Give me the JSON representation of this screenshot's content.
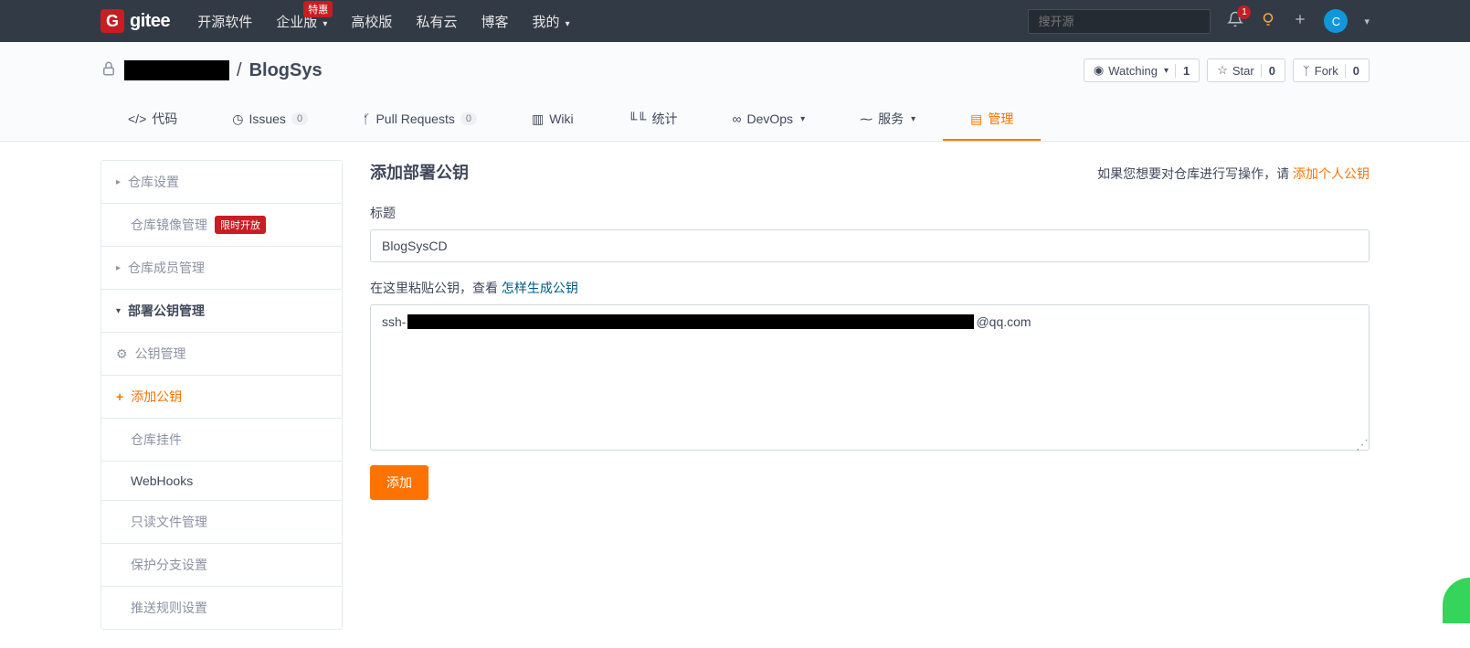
{
  "top": {
    "brand": "gitee",
    "nav": [
      "开源软件",
      "企业版",
      "高校版",
      "私有云",
      "博客",
      "我的"
    ],
    "promo_badge": "特惠",
    "search_placeholder": "搜开源",
    "notif_count": "1",
    "avatar_letter": "C"
  },
  "repo": {
    "separator": "/",
    "name": "BlogSys",
    "actions": {
      "watch": "Watching",
      "watch_count": "1",
      "star": "Star",
      "star_count": "0",
      "fork": "Fork",
      "fork_count": "0"
    },
    "tabs": {
      "code": "代码",
      "issues": "Issues",
      "issues_count": "0",
      "pr": "Pull Requests",
      "pr_count": "0",
      "wiki": "Wiki",
      "stats": "统计",
      "devops": "DevOps",
      "services": "服务",
      "manage": "管理"
    }
  },
  "sidebar": {
    "repo_settings": "仓库设置",
    "mirror": "仓库镜像管理",
    "mirror_badge": "限时开放",
    "members": "仓库成员管理",
    "deploy_keys": "部署公钥管理",
    "key_manage": "公钥管理",
    "add_key": "添加公钥",
    "plugins": "仓库挂件",
    "webhooks": "WebHooks",
    "readonly": "只读文件管理",
    "branches": "保护分支设置",
    "push_rules": "推送规则设置"
  },
  "form": {
    "title": "添加部署公钥",
    "hint_prefix": "如果您想要对仓库进行写操作，请 ",
    "hint_link": "添加个人公钥",
    "label_title": "标题",
    "value_title": "BlogSysCD",
    "paste_prefix": "在这里粘贴公钥，查看 ",
    "paste_link": "怎样生成公钥",
    "key_prefix": "ssh-",
    "key_suffix": "@qq.com",
    "submit": "添加"
  }
}
